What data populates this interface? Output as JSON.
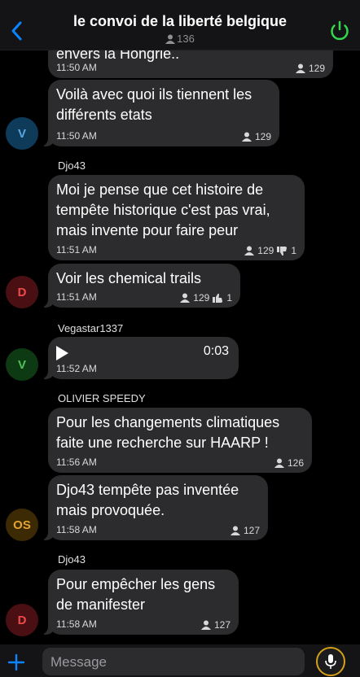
{
  "header": {
    "title": "le convoi de la liberté belgique",
    "member_count": "136"
  },
  "messages": [
    {
      "text_lines": [
        "envers la Hongrie.."
      ],
      "time": "11:50 AM",
      "views": "129"
    },
    {
      "text_lines": [
        "Voilà avec quoi ils tiennent les",
        "différents etats"
      ],
      "time": "11:50 AM",
      "views": "129",
      "avatar": "V"
    },
    {
      "sender": "Djo43",
      "text_lines": [
        "Moi je pense que cet histoire de",
        "tempête historique c'est pas vrai,",
        "mais invente pour faire peur"
      ],
      "time": "11:51 AM",
      "views": "129",
      "reaction_count": "1"
    },
    {
      "text_lines": [
        "Voir les chemical trails"
      ],
      "time": "11:51 AM",
      "views": "129",
      "reaction_count": "1",
      "avatar": "D"
    },
    {
      "sender": "Vegastar1337",
      "duration": "0:03",
      "time": "11:52 AM",
      "avatar": "V"
    },
    {
      "sender": "OLIVIER SPEEDY",
      "text_lines": [
        "Pour les changements climatiques",
        "faite une recherche sur HAARP !"
      ],
      "time": "11:56 AM",
      "views": "126"
    },
    {
      "text_lines": [
        "Djo43 tempête pas inventée",
        "mais provoquée."
      ],
      "time": "11:58 AM",
      "views": "127",
      "avatar": "OS"
    },
    {
      "sender": "Djo43",
      "text_lines": [
        "Pour empêcher les gens",
        "de manifester"
      ],
      "time": "11:58 AM",
      "views": "127",
      "avatar": "D"
    }
  ],
  "composer": {
    "placeholder": "Message"
  },
  "colors": {
    "bubble": "#2c2c2e",
    "accent_blue": "#0a84ff",
    "power_green": "#32d74b",
    "mic_ring": "#d4a017"
  },
  "icons": [
    "back-chevron-icon",
    "power-icon",
    "person-icon",
    "thumbs-down-icon",
    "thumbs-up-icon",
    "play-icon",
    "plus-icon",
    "mic-icon"
  ]
}
